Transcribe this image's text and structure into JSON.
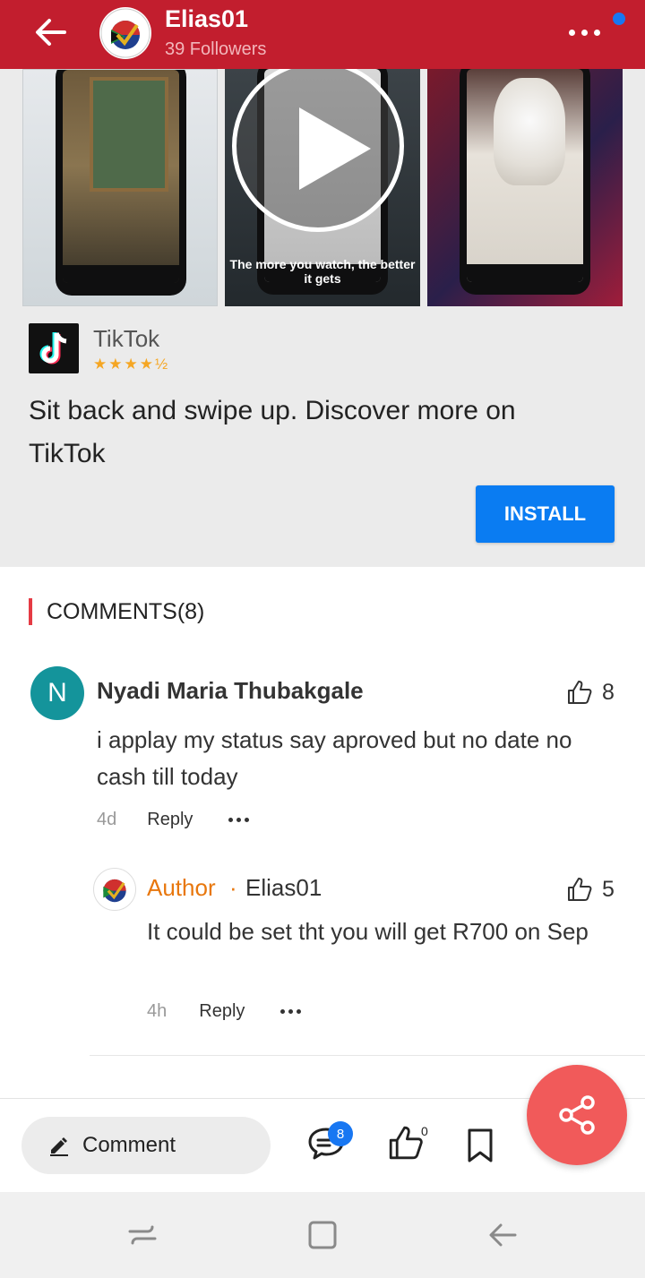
{
  "header": {
    "title": "Elias01",
    "subtitle": "39 Followers",
    "back_icon": "arrow-left-icon",
    "more_icon": "more-horizontal-icon"
  },
  "ad": {
    "screenshot_caption": "The more you watch, the better it gets",
    "app_name": "TikTok",
    "rating_stars": "★★★★½",
    "headline": "Sit back and swipe up. Discover more on TikTok",
    "install_label": "INSTALL"
  },
  "comments": {
    "title": "COMMENTS(8)",
    "items": [
      {
        "avatar_letter": "N",
        "name": "Nyadi Maria Thubakgale",
        "likes": "8",
        "text": "i applay my status say aproved but no date no cash till today",
        "time": "4d",
        "reply_label": "Reply"
      }
    ],
    "reply": {
      "author_tag": "Author",
      "separator": "·",
      "name": "Elias01",
      "likes": "5",
      "text": "It could be set tht you will get R700 on Sep",
      "time": "4h",
      "reply_label": "Reply"
    }
  },
  "bottom_bar": {
    "comment_label": "Comment",
    "comment_count": "8",
    "like_count": "0"
  },
  "colors": {
    "header_bg": "#c21e2e",
    "install_blue": "#0a7cf2",
    "author_orange": "#e8770d",
    "fab_red": "#f15a5a",
    "avatar_teal": "#14949b"
  }
}
